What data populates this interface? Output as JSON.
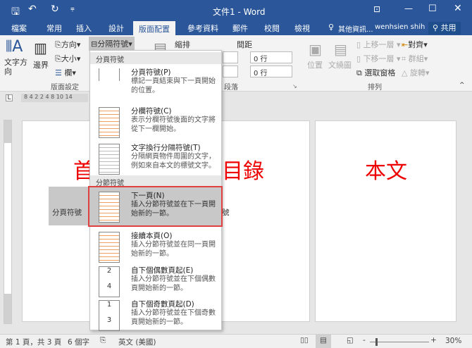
{
  "title": "文件1 - Word",
  "tabs": [
    "檔案",
    "常用",
    "插入",
    "設計",
    "版面配置",
    "參考資料",
    "郵件",
    "校閱",
    "檢視"
  ],
  "tell_me": "其他資訊...",
  "user": "wenhsien shih",
  "share": "共用",
  "ribbon": {
    "text_direction": "文字方向",
    "margins": "邊界",
    "orientation": "方向",
    "size": "大小",
    "columns": "欄",
    "breaks": "分隔符號",
    "indent": "縮排",
    "spacing": "間距",
    "spacing_before": "0 行",
    "spacing_after": "0 行",
    "page_setup": "版面設定",
    "paragraph": "段落",
    "position": "位置",
    "wrap_text": "文繞圖",
    "bring_forward": "上移一層",
    "send_backward": "下移一層",
    "selection_pane": "選取窗格",
    "align": "對齊",
    "group": "群組",
    "rotate": "旋轉",
    "arrange": "排列"
  },
  "ruler": "8  4 2  2 4  8 10 14",
  "menu": {
    "header1": "分頁符號",
    "header2": "分節符號",
    "items": [
      {
        "title": "分頁符號(P)",
        "desc": "標記一頁結束與下一頁開始的位置。"
      },
      {
        "title": "分欄符號(C)",
        "desc": "表示分欄符號後面的文字將從下一欄開始。"
      },
      {
        "title": "文字換行分隔符號(T)",
        "desc": "分隔網頁物件周圍的文字，例如來自本文的標號文字。"
      },
      {
        "title": "下一頁(N)",
        "desc": "插入分節符號並在下一頁開始新的一節。"
      },
      {
        "title": "接續本頁(O)",
        "desc": "插入分節符號並在同一頁開始新的一節。"
      },
      {
        "title": "自下個偶數頁起(E)",
        "desc": "插入分節符號並在下個偶數頁開始新的一節。"
      },
      {
        "title": "自下個奇數頁起(D)",
        "desc": "插入分節符號並在下個奇數頁開始新的一節。"
      }
    ]
  },
  "doc": {
    "page1_title": "首",
    "page2_title": "目錄",
    "page3_title": "本文",
    "break_mark": "分頁符號",
    "break_mark2": "號"
  },
  "status": {
    "page": "第 1 頁，共 3 頁",
    "words": "6 個字",
    "lang": "英文 (美國)",
    "zoom": "30%"
  },
  "colors": {
    "accent": "#2b579a",
    "red": "#e00000"
  }
}
